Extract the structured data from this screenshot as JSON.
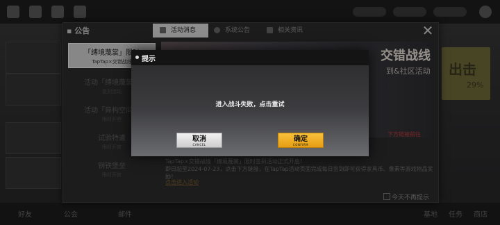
{
  "background": {
    "resources": [
      "",
      "",
      "",
      ""
    ],
    "right_button": {
      "title": "出击",
      "value": "29%"
    },
    "bottom_labels": [
      "好友",
      "公会",
      "邮件",
      "",
      "基地",
      "任务",
      "商店"
    ]
  },
  "announcement": {
    "title": "公告",
    "tabs": [
      {
        "label": "活动消息",
        "icon": "book-icon",
        "active": true
      },
      {
        "label": "系统公告",
        "icon": "gear-icon",
        "active": false
      },
      {
        "label": "相关资讯",
        "icon": "news-icon",
        "active": false
      }
    ],
    "list": [
      {
        "title": "「缚境蔑裳」限时",
        "sub": "TapTap×交错战线",
        "active": true
      },
      {
        "title": "活动「缚境蔑裳」",
        "sub": "复刻活动",
        "active": false
      },
      {
        "title": "活动「异构空间」",
        "sub": "限时开启",
        "active": false
      },
      {
        "title": "试验特遣",
        "sub": "限时开放",
        "active": false
      },
      {
        "title": "钢铁堡垒",
        "sub": "限时开放",
        "active": false
      }
    ],
    "banner": {
      "headline": "交错战线",
      "subline": "到&社区活动",
      "cta": "下方链接前往"
    },
    "body_lines": [
      "TapTap×交错战线「缚境蔑裳」限时签到活动正式开启！",
      "即日起至2024-07-23，点击下方链接，在TapTap活动页面完成每日签到即可获得家具币、像素等游戏物品奖励！"
    ],
    "link": "点击进入活动",
    "dont_show_today": "今天不再提示"
  },
  "dialog": {
    "title": "提示",
    "message": "进入战斗失败，点击重试",
    "cancel": {
      "label": "取消",
      "sub": "CANCEL"
    },
    "confirm": {
      "label": "确定",
      "sub": "CONFIRM"
    }
  }
}
